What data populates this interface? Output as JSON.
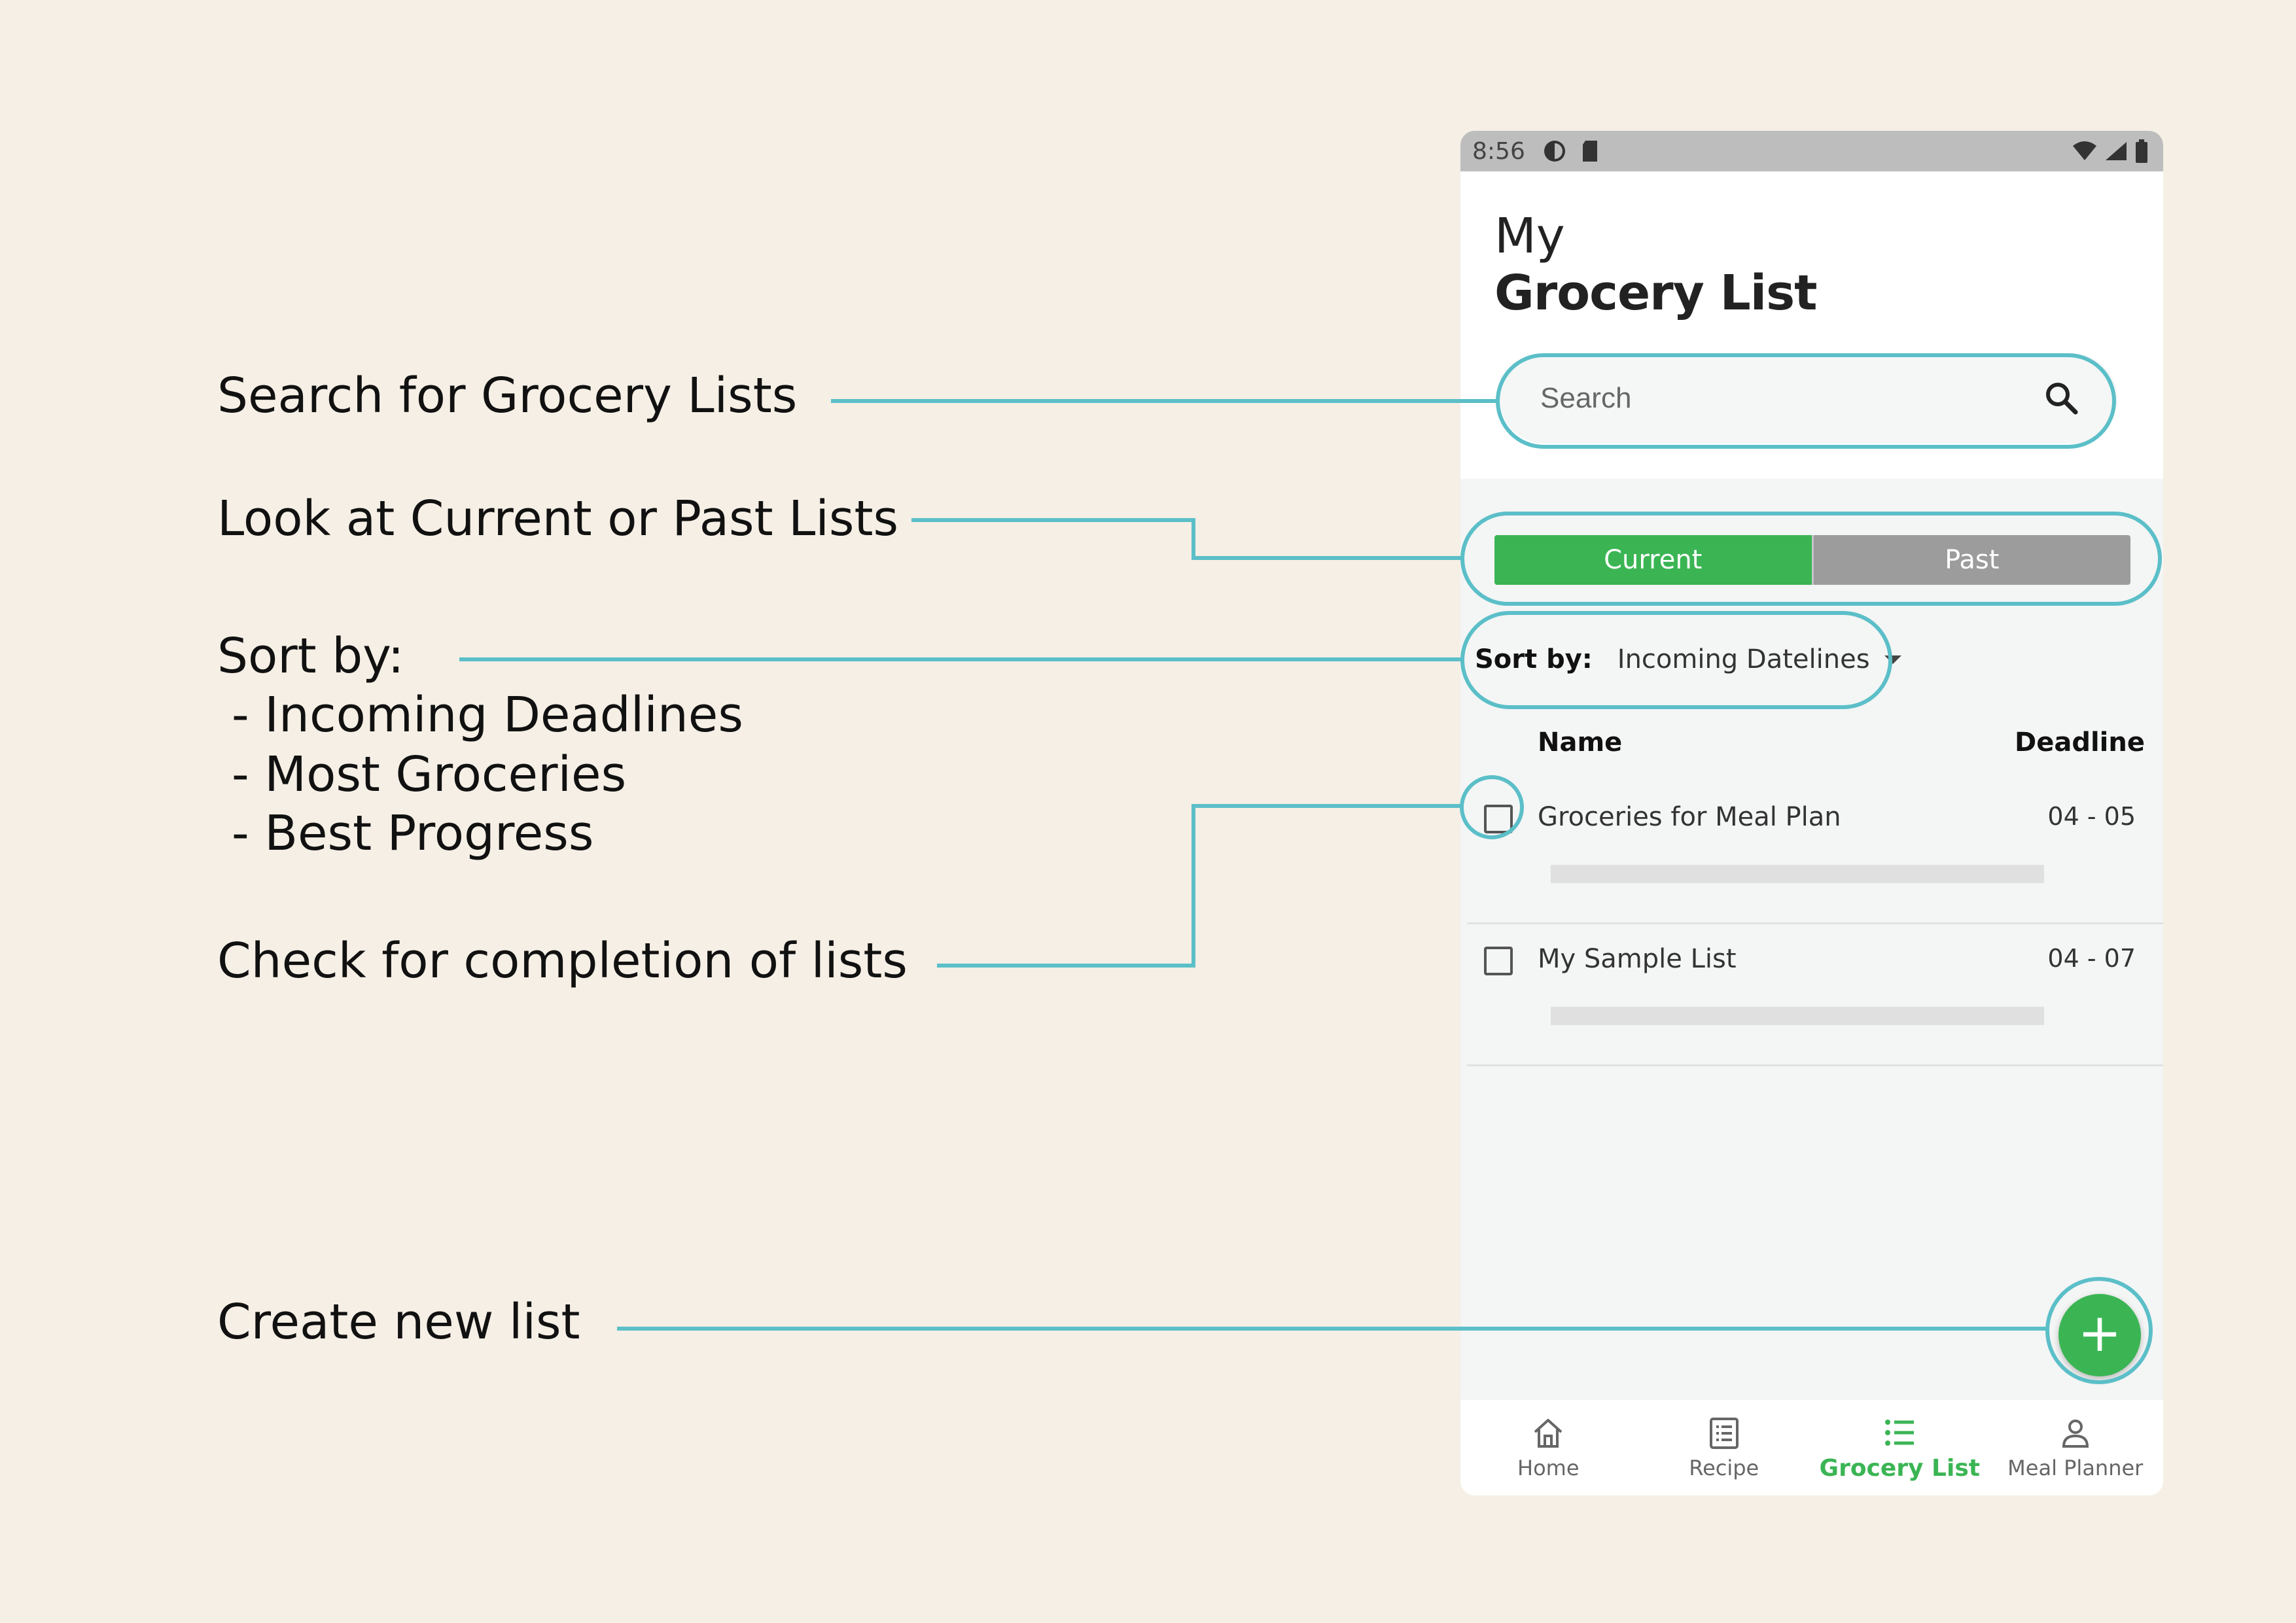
{
  "annotations": {
    "search": "Search for Grocery Lists",
    "tabs": "Look at Current or Past Lists",
    "sort_title": "Sort by:",
    "sort_options": [
      "- Incoming Deadlines",
      "- Most Groceries",
      "- Best Progress"
    ],
    "check": "Check for completion of lists",
    "create": "Create new list"
  },
  "status_bar": {
    "time": "8:56"
  },
  "header": {
    "title_small": "My",
    "title_big": "Grocery List"
  },
  "search": {
    "placeholder": "Search"
  },
  "tabs": {
    "current": "Current",
    "past": "Past",
    "selected": "current"
  },
  "sort": {
    "label": "Sort by:",
    "value": "Incoming Datelines"
  },
  "table": {
    "col_name": "Name",
    "col_deadline": "Deadline",
    "rows": [
      {
        "name": "Groceries for Meal Plan",
        "deadline": "04 - 05",
        "checked": false,
        "progress": 0
      },
      {
        "name": "My Sample List",
        "deadline": "04 - 07",
        "checked": false,
        "progress": 0
      }
    ]
  },
  "fab": {
    "symbol": "+"
  },
  "nav": {
    "items": [
      {
        "label": "Home",
        "icon": "home-icon",
        "active": false
      },
      {
        "label": "Recipe",
        "icon": "recipe-icon",
        "active": false
      },
      {
        "label": "Grocery List",
        "icon": "list-icon",
        "active": true
      },
      {
        "label": "Meal Planner",
        "icon": "person-icon",
        "active": false
      }
    ]
  },
  "colors": {
    "accent": "#3bb554",
    "annotation_line": "#5bbfc8",
    "background": "#f5efe5",
    "tab_inactive": "#9c9c9c"
  }
}
